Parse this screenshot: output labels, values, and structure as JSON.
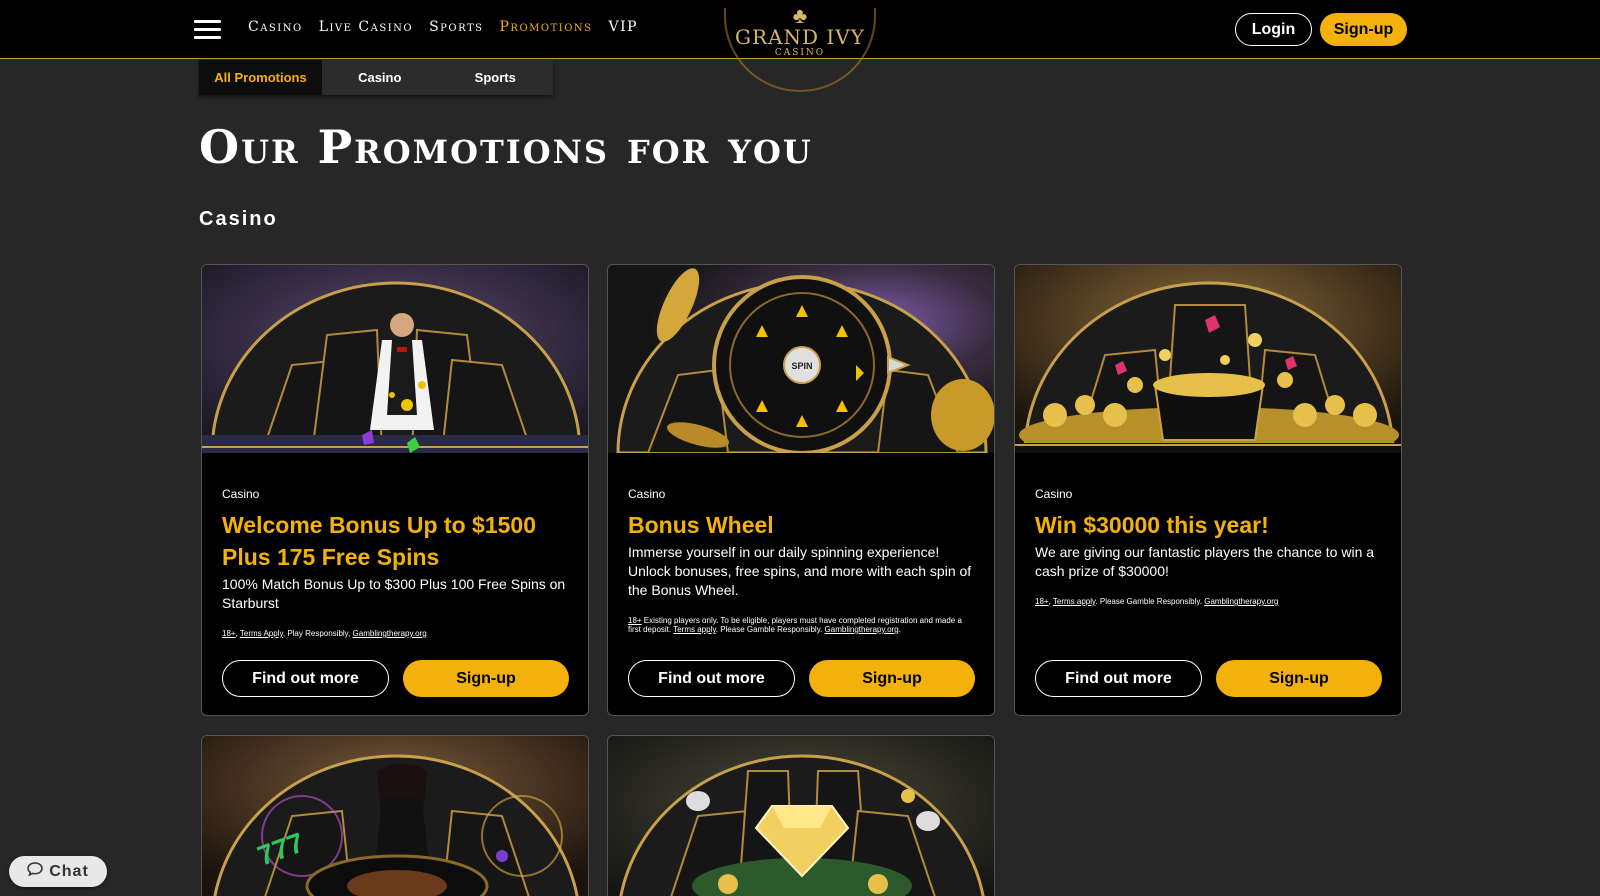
{
  "header": {
    "nav": [
      "Casino",
      "Live Casino",
      "Sports",
      "Promotions",
      "VIP"
    ],
    "active_nav": "Promotions",
    "logo": {
      "title": "GRAND IVY",
      "subtitle": "CASINO"
    },
    "login_label": "Login",
    "signup_label": "Sign-up"
  },
  "tabs": [
    {
      "label": "All Promotions",
      "active": true
    },
    {
      "label": "Casino",
      "active": false
    },
    {
      "label": "Sports",
      "active": false
    }
  ],
  "page_title": "Our Promotions for you",
  "section_title": "Casino",
  "cards": [
    {
      "category": "Casino",
      "title": "Welcome Bonus Up to $1500 Plus 175 Free Spins",
      "description": "100% Match Bonus Up to $300 Plus 100 Free Spins on Starburst",
      "terms": {
        "age": "18+",
        "link1": "Terms Apply",
        "mid": ", Play Responsibly, ",
        "link2": "Gamblingtherapy.org",
        "end": ""
      },
      "find_label": "Find out more",
      "signup_label": "Sign-up",
      "image_theme": "live-dealer"
    },
    {
      "category": "Casino",
      "title": "Bonus Wheel",
      "description": "Immerse yourself in our daily spinning experience! Unlock bonuses, free spins, and more with each spin of the Bonus Wheel.",
      "terms": {
        "age": "18+",
        "pre": " Existing players only. To be eligible, players must have completed registration and made a first deposit. ",
        "link1": "Terms apply",
        "mid": ". Please Gamble Responsibly. ",
        "link2": "Gamblingtherapy.org",
        "end": "."
      },
      "find_label": "Find out more",
      "signup_label": "Sign-up",
      "wheel_label": "SPIN",
      "image_theme": "bonus-wheel"
    },
    {
      "category": "Casino",
      "title": "Win $30000 this year!",
      "description": "We are giving our fantastic players the chance to win a cash prize of $30000!",
      "terms": {
        "age": "18+",
        "link1": "Terms apply",
        "mid": ". Please Gamble Responsibly. ",
        "link2": "Gamblingtherapy.org",
        "end": ""
      },
      "find_label": "Find out more",
      "signup_label": "Sign-up",
      "image_theme": "gold-pot"
    }
  ],
  "chat": {
    "label": "Chat",
    "icon": "speech-bubble-icon"
  },
  "colors": {
    "accent": "#f5b10b",
    "background": "#272727",
    "header": "#000000"
  }
}
